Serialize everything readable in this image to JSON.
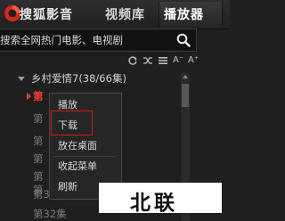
{
  "header": {
    "app_name": "搜狐影音",
    "app_dropdown": "▾",
    "tabs": [
      {
        "label": "视频库",
        "active": false
      },
      {
        "label": "播放器",
        "active": true
      }
    ]
  },
  "search": {
    "value": "搜索全网热门电影、电视剧",
    "icon": "search-icon"
  },
  "toolbar": {
    "icons": [
      "refresh-icon",
      "shuffle-icon",
      "list-mode-icon",
      "font-decrease-icon",
      "font-increase-icon"
    ],
    "font_decrease_label": "A⁻",
    "font_increase_label": "A⁺"
  },
  "playlist": {
    "title": "乡村爱情7(38/66集)",
    "episodes": [
      {
        "label": "第",
        "active": true
      },
      {
        "label": "第",
        "active": false
      },
      {
        "label": "第",
        "active": false
      },
      {
        "label": "第",
        "active": false
      },
      {
        "label": "第",
        "active": false
      },
      {
        "label": "第",
        "active": false
      },
      {
        "label": "第31集",
        "active": false
      },
      {
        "label": "第32集",
        "active": false
      }
    ]
  },
  "context_menu": {
    "items": [
      "播放",
      "下载",
      "放在桌面",
      "收起菜单",
      "刷新"
    ],
    "highlighted": "下载"
  },
  "watermark": {
    "text": "北联"
  },
  "colors": {
    "accent_red": "#ff3b3b",
    "highlight_border": "#d21c1c",
    "background": "#1f1f1f"
  }
}
